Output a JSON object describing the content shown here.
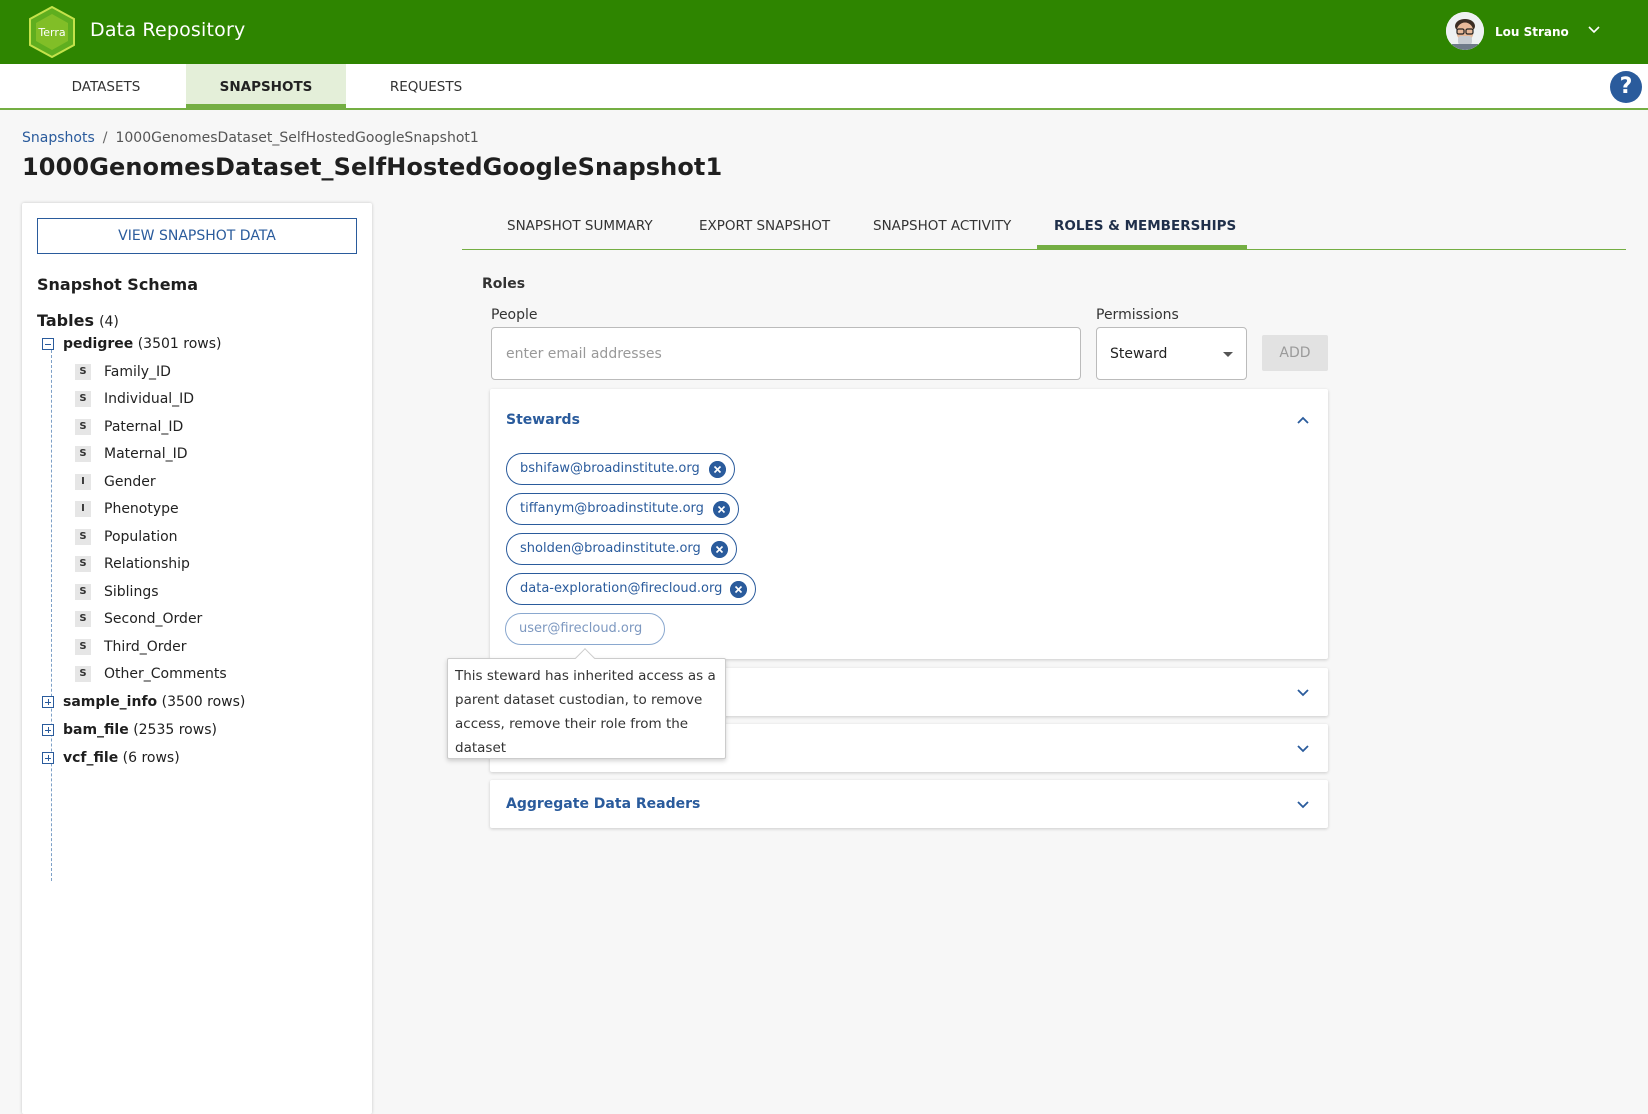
{
  "header": {
    "logo_text": "Terra",
    "app_title": "Data Repository",
    "user_name": "Lou Strano"
  },
  "nav": {
    "tabs": [
      {
        "label": "DATASETS",
        "active": false
      },
      {
        "label": "SNAPSHOTS",
        "active": true
      },
      {
        "label": "REQUESTS",
        "active": false
      }
    ],
    "help_label": "?"
  },
  "breadcrumb": {
    "root": "Snapshots",
    "separator": "/",
    "current": "1000GenomesDataset_SelfHostedGoogleSnapshot1"
  },
  "page_title": "1000GenomesDataset_SelfHostedGoogleSnapshot1",
  "schema_panel": {
    "view_button": "VIEW SNAPSHOT DATA",
    "schema_title": "Snapshot Schema",
    "tables_label": "Tables",
    "tables_count": "(4)",
    "tables": [
      {
        "name": "pedigree",
        "rows": "(3501 rows)",
        "expanded": true,
        "columns": [
          {
            "type": "S",
            "name": "Family_ID"
          },
          {
            "type": "S",
            "name": "Individual_ID"
          },
          {
            "type": "S",
            "name": "Paternal_ID"
          },
          {
            "type": "S",
            "name": "Maternal_ID"
          },
          {
            "type": "I",
            "name": "Gender"
          },
          {
            "type": "I",
            "name": "Phenotype"
          },
          {
            "type": "S",
            "name": "Population"
          },
          {
            "type": "S",
            "name": "Relationship"
          },
          {
            "type": "S",
            "name": "Siblings"
          },
          {
            "type": "S",
            "name": "Second_Order"
          },
          {
            "type": "S",
            "name": "Third_Order"
          },
          {
            "type": "S",
            "name": "Other_Comments"
          }
        ]
      },
      {
        "name": "sample_info",
        "rows": "(3500 rows)",
        "expanded": false
      },
      {
        "name": "bam_file",
        "rows": "(2535 rows)",
        "expanded": false
      },
      {
        "name": "vcf_file",
        "rows": "(6 rows)",
        "expanded": false
      }
    ]
  },
  "snapshot_tabs": [
    {
      "label": "SNAPSHOT SUMMARY",
      "active": false
    },
    {
      "label": "EXPORT SNAPSHOT",
      "active": false
    },
    {
      "label": "SNAPSHOT ACTIVITY",
      "active": false
    },
    {
      "label": "ROLES & MEMBERSHIPS",
      "active": true
    }
  ],
  "roles": {
    "title": "Roles",
    "people_label": "People",
    "people_placeholder": "enter email addresses",
    "permissions_label": "Permissions",
    "permissions_value": "Steward",
    "add_label": "ADD",
    "sections": [
      {
        "title": "Stewards",
        "expanded": true,
        "members": [
          "bshifaw@broadinstitute.org",
          "tiffanym@broadinstitute.org",
          "sholden@broadinstitute.org",
          "data-exploration@firecloud.org"
        ],
        "inherited_members": [
          "user@firecloud.org"
        ]
      },
      {
        "title": "",
        "expanded": false
      },
      {
        "title": "",
        "expanded": false
      },
      {
        "title": "Aggregate Data Readers",
        "expanded": false
      }
    ],
    "tooltip": "This steward has inherited access as a parent dataset custodian, to remove access, remove their role from the dataset"
  },
  "colors": {
    "brand_green": "#2e8500",
    "accent_green": "#74ae43",
    "link_blue": "#2a5b9c"
  },
  "icons": {
    "logo": "terra-hexagon-logo",
    "user_menu": "chevron-down-icon",
    "help": "help-circle-icon",
    "remove_chip": "remove-circle-icon",
    "accordion_open": "chevron-up-icon",
    "accordion_closed": "chevron-down-icon"
  }
}
